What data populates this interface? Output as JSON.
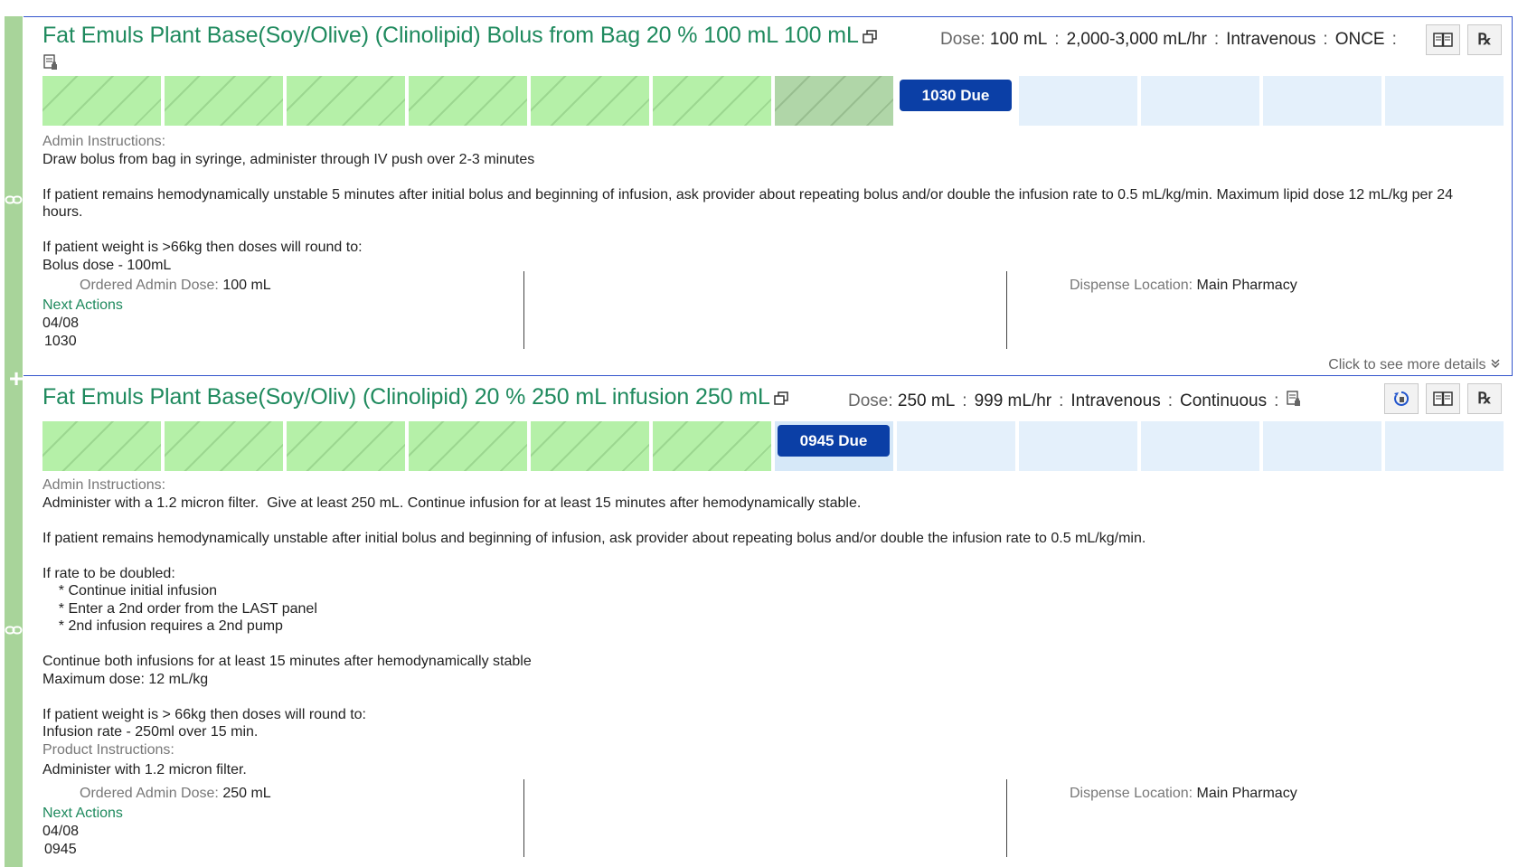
{
  "colors": {
    "title_green": "#1f8a5e",
    "gutter_green": "#a8d49a",
    "given_cell": "#b5f0a8",
    "due_button": "#0b3fa6",
    "future_cell": "#e4f0fb",
    "border_blue": "#3355cc"
  },
  "gutter": {
    "icons": [
      "link-icon",
      "plus-icon"
    ]
  },
  "orders": [
    {
      "title": "Fat Emuls Plant Base(Soy/Olive) (Clinolipid) Bolus from Bag 20 % 100 mL 100 mL",
      "dose_label": "Dose:",
      "dose": "100 mL",
      "rate": "2,000-3,000 mL/hr",
      "route": "Intravenous",
      "frequency": "ONCE",
      "due_label": "1030 Due",
      "timeline": [
        "given",
        "given",
        "given",
        "given",
        "given",
        "given",
        "past",
        "due",
        "future",
        "future",
        "future",
        "future"
      ],
      "admin_instructions_label": "Admin Instructions:",
      "admin_instructions": [
        "Draw bolus from bag in syringe, administer through IV push over 2-3 minutes",
        "",
        "If patient remains hemodynamically unstable 5 minutes after initial bolus and beginning of infusion, ask provider about repeating bolus and/or double the infusion rate to 0.5 mL/kg/min. Maximum lipid dose 12 mL/kg per 24 hours.",
        "",
        "If patient weight is >66kg then doses will round to:",
        "Bolus dose - 100mL"
      ],
      "ordered_admin_dose_label": "Ordered Admin Dose:",
      "ordered_admin_dose": "100 mL",
      "dispense_location_label": "Dispense Location:",
      "dispense_location": "Main Pharmacy",
      "next_actions_label": "Next Actions",
      "next_actions_date": "04/08",
      "next_actions_time": "1030",
      "more_details": "Click to see more details"
    },
    {
      "title": "Fat Emuls Plant Base(Soy/Oliv) (Clinolipid) 20 % 250 mL infusion 250 mL",
      "dose_label": "Dose:",
      "dose": "250 mL",
      "rate": "999 mL/hr",
      "route": "Intravenous",
      "frequency": "Continuous",
      "due_label": "0945 Due",
      "timeline": [
        "given",
        "given",
        "given",
        "given",
        "given",
        "given",
        "due",
        "future",
        "future",
        "future",
        "future",
        "future"
      ],
      "admin_instructions_label": "Admin Instructions:",
      "admin_instructions": [
        "Administer with a 1.2 micron filter.  Give at least 250 mL. Continue infusion for at least 15 minutes after hemodynamically stable.",
        "",
        "If patient remains hemodynamically unstable after initial bolus and beginning of infusion, ask provider about repeating bolus and/or double the infusion rate to 0.5 mL/kg/min.",
        "",
        "If rate to be doubled:",
        "    * Continue initial infusion",
        "    * Enter a 2nd order from the LAST panel",
        "    * 2nd infusion requires a 2nd pump",
        "",
        "Continue both infusions for at least 15 minutes after hemodynamically stable",
        "Maximum dose: 12 mL/kg",
        "",
        "If patient weight is > 66kg then doses will round to:",
        "Infusion rate - 250ml over 15 min."
      ],
      "product_instructions_label": "Product Instructions:",
      "product_instructions": "Administer with 1.2 micron filter.",
      "ordered_admin_dose_label": "Ordered Admin Dose:",
      "ordered_admin_dose": "250 mL",
      "dispense_location_label": "Dispense Location:",
      "dispense_location": "Main Pharmacy",
      "next_actions_label": "Next Actions",
      "next_actions_date": "04/08",
      "next_actions_time": "0945"
    }
  ]
}
